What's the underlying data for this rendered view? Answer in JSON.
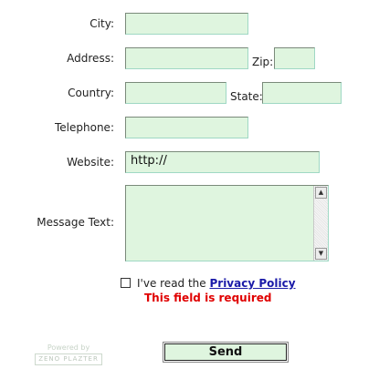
{
  "form": {
    "city": {
      "label": "City:",
      "value": ""
    },
    "address": {
      "label": "Address:",
      "value": ""
    },
    "zip": {
      "label": "Zip:",
      "value": ""
    },
    "country": {
      "label": "Country:",
      "value": ""
    },
    "state": {
      "label": "State:",
      "value": ""
    },
    "telephone": {
      "label": "Telephone:",
      "value": ""
    },
    "website": {
      "label": "Website:",
      "value": "http://"
    },
    "message": {
      "label": "Message Text:",
      "value": ""
    },
    "privacy": {
      "prefix": "I've read the ",
      "link": "Privacy Policy",
      "checked": false,
      "error": "This field is required"
    },
    "send_label": "Send"
  },
  "footer": {
    "powered_by": "Powered by",
    "brand": "ZENO PLAZTER"
  },
  "colors": {
    "field_bg": "#dff5df",
    "error": "#e00000",
    "link": "#1a1aa8"
  },
  "icons": {
    "scroll_up": "up-arrow-icon",
    "scroll_down": "down-arrow-icon"
  }
}
